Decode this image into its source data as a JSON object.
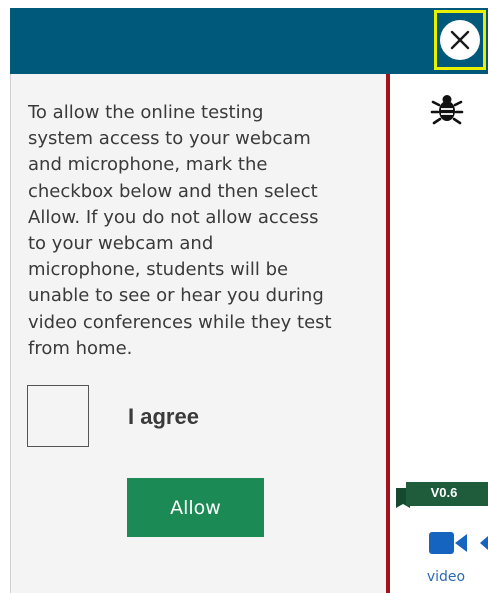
{
  "dialog": {
    "message": "To allow the online testing\nsystem access to your webcam\nand microphone, mark the\ncheckbox below and then select\nAllow. If you do not allow access\nto your webcam and\nmicrophone, students will be\nunable to see or hear you during\nvideo conferences while they test\nfrom home.",
    "checkbox_label": "I agree",
    "checkbox_checked": false,
    "allow_label": "Allow",
    "close_icon": "close-icon"
  },
  "toolbar": {
    "debug_icon": "bug-icon",
    "version": "V0.6",
    "video_label": "video",
    "video_icon": "video-camera-icon"
  },
  "colors": {
    "header": "#00587a",
    "close_focus_outline": "#e8f000",
    "allow_button": "#1b8a55",
    "divider": "#a0141e",
    "version_ribbon": "#1e5c3c",
    "video_icon": "#1565c0"
  }
}
